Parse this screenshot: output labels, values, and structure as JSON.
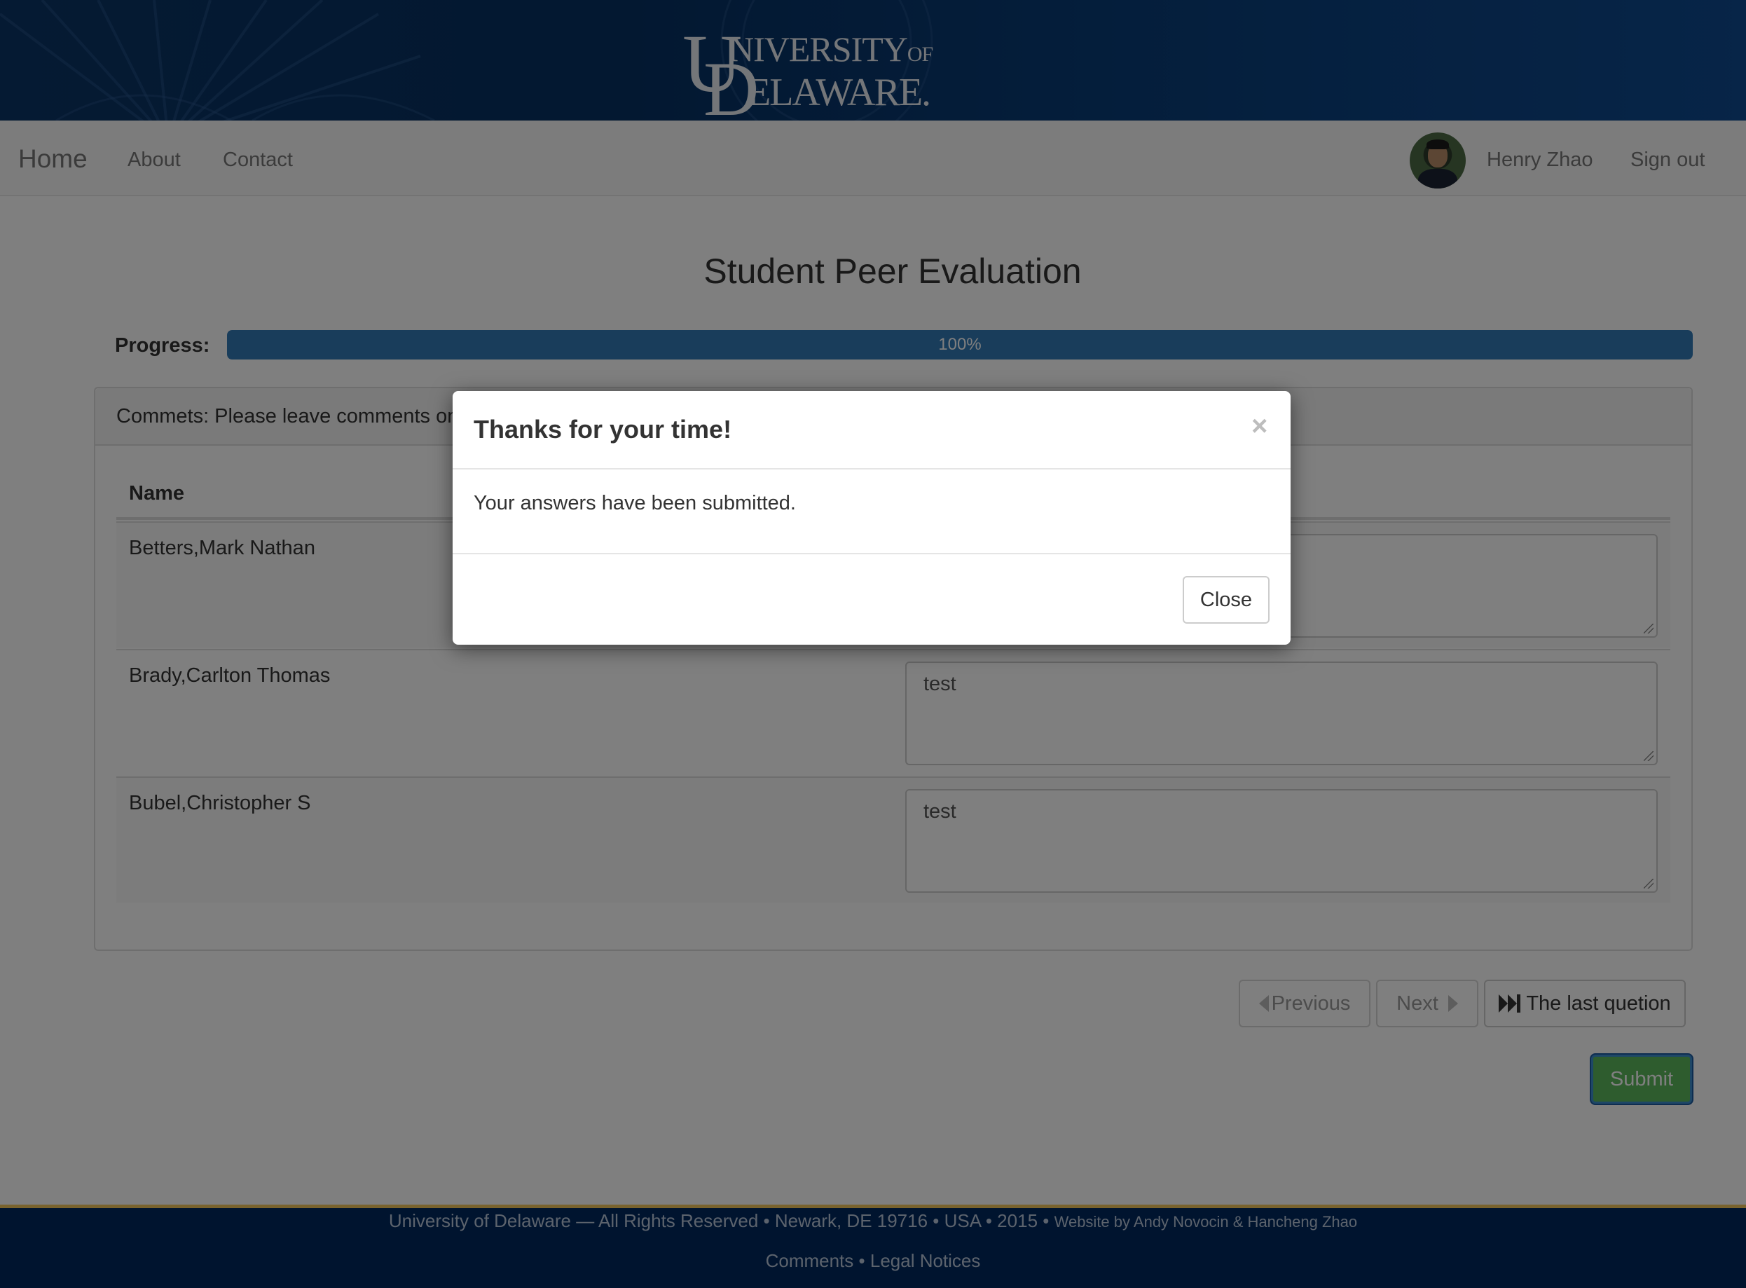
{
  "header": {
    "logo_line1": "NIVERSITY",
    "logo_of": "OF",
    "logo_line2": "ELAWARE.",
    "logo_u": "U",
    "logo_d": "D"
  },
  "navbar": {
    "brand": "Home",
    "links": [
      "About",
      "Contact"
    ],
    "user_name": "Henry Zhao",
    "sign_out": "Sign out"
  },
  "page": {
    "title": "Student Peer Evaluation",
    "progress_label": "Progress:",
    "progress_text": "100%",
    "progress_fraction": 1.0
  },
  "panel": {
    "heading": "Commets: Please leave comments on",
    "column_name": "Name",
    "rows": [
      {
        "name": "Betters,Mark Nathan",
        "comment": ""
      },
      {
        "name": "Brady,Carlton Thomas",
        "comment": "test"
      },
      {
        "name": "Bubel,Christopher S",
        "comment": "test"
      }
    ]
  },
  "pagination": {
    "previous": "Previous",
    "next": "Next",
    "last": "The last quetion"
  },
  "submit_label": "Submit",
  "footer": {
    "line1_main": "University of Delaware — All Rights Reserved • Newark, DE 19716 • USA • 2015 •",
    "line1_credit": "Website by Andy Novocin & Hancheng Zhao",
    "comments": "Comments",
    "separator": "•",
    "legal": "Legal Notices"
  },
  "modal": {
    "title": "Thanks for your time!",
    "close_x": "×",
    "body": "Your answers have been submitted.",
    "close_button": "Close"
  },
  "colors": {
    "header_blue": "#063062",
    "progress_blue": "#337ab7",
    "submit_green": "#5cb85c",
    "footer_navy": "#00295f",
    "footer_gold": "#f2c75c"
  }
}
